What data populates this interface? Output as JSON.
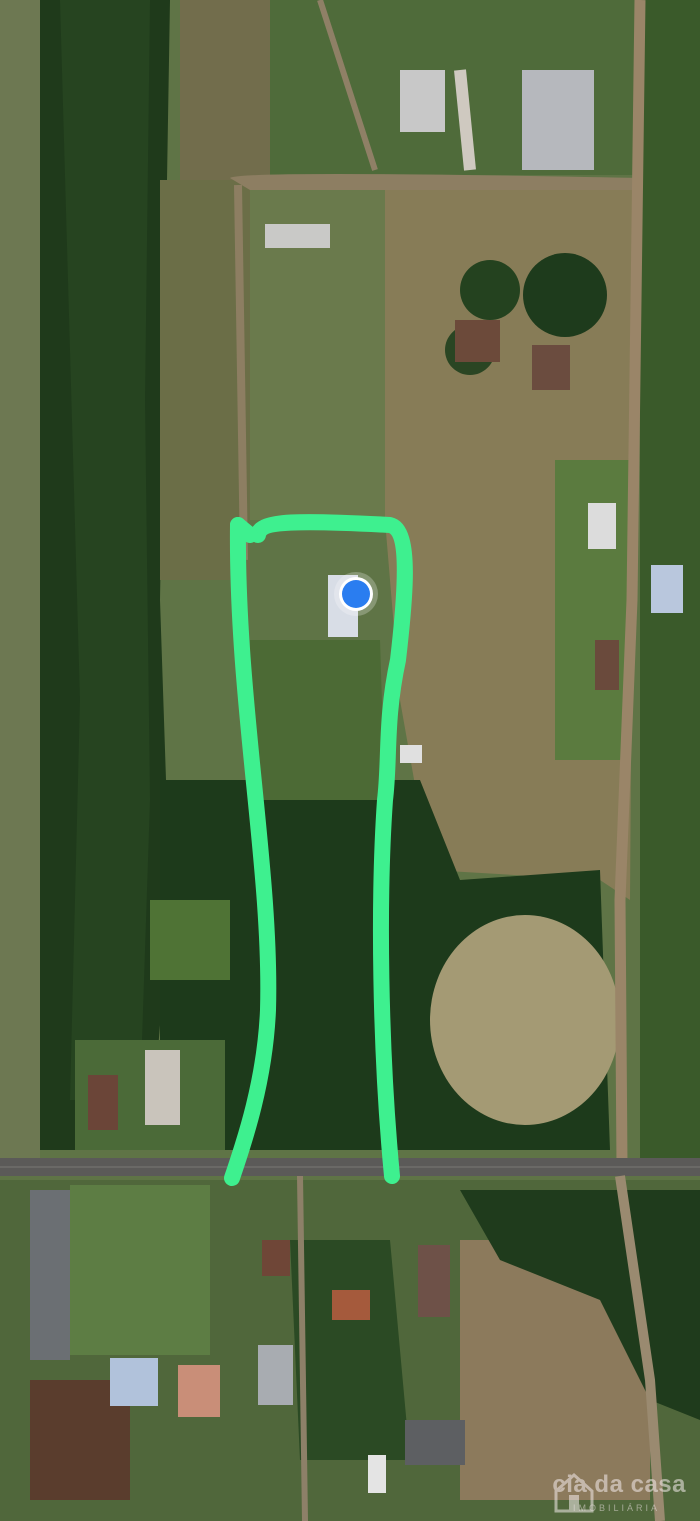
{
  "map": {
    "type": "satellite",
    "location_marker": "current-location-dot",
    "boundary_color": "#3ef08f",
    "marker_color": "#2a7df0"
  },
  "watermark": {
    "logo_icon": "house-logo-icon",
    "brand": "cia da casa",
    "subtitle": "IMOBILIÁRIA"
  }
}
